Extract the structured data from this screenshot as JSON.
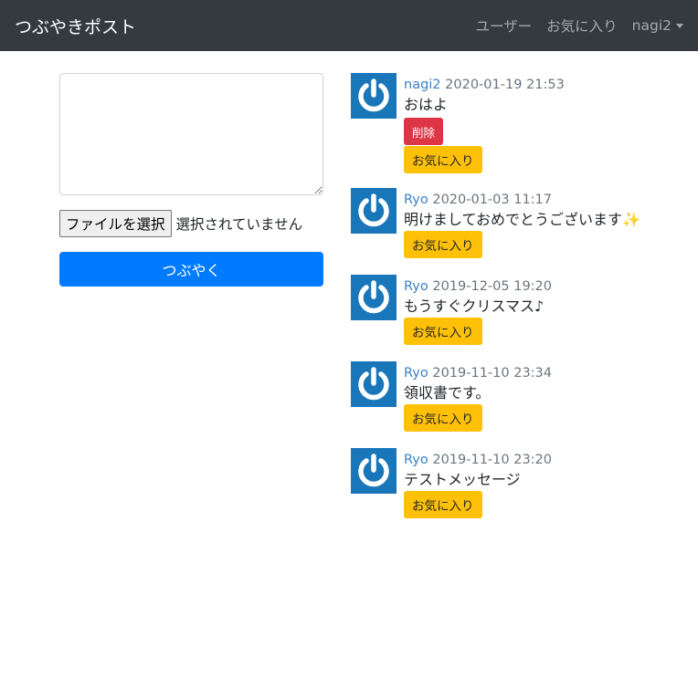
{
  "navbar": {
    "brand": "つぶやきポスト",
    "links": [
      "ユーザー",
      "お気に入り"
    ],
    "user": "nagi2"
  },
  "form": {
    "textarea_value": "",
    "file_button": "ファイルを選択",
    "file_status": "選択されていません",
    "submit": "つぶやく"
  },
  "posts": [
    {
      "user": "nagi2",
      "date": "2020-01-19 21:53",
      "text": "おはよ",
      "delete": "削除",
      "favorite": "お気に入り"
    },
    {
      "user": "Ryo",
      "date": "2020-01-03 11:17",
      "text": "明けましておめでとうございます✨",
      "favorite": "お気に入り"
    },
    {
      "user": "Ryo",
      "date": "2019-12-05 19:20",
      "text": "もうすぐクリスマス♪",
      "favorite": "お気に入り"
    },
    {
      "user": "Ryo",
      "date": "2019-11-10 23:34",
      "text": "領収書です。",
      "favorite": "お気に入り"
    },
    {
      "user": "Ryo",
      "date": "2019-11-10 23:20",
      "text": "テストメッセージ",
      "favorite": "お気に入り"
    }
  ],
  "colors": {
    "navbar_bg": "#343a40",
    "primary": "#007bff",
    "danger": "#dc3545",
    "warning": "#ffc107",
    "avatar_bg": "#1876b9"
  },
  "icons": {
    "avatar": "power-icon",
    "user_menu": "caret-down-icon"
  }
}
